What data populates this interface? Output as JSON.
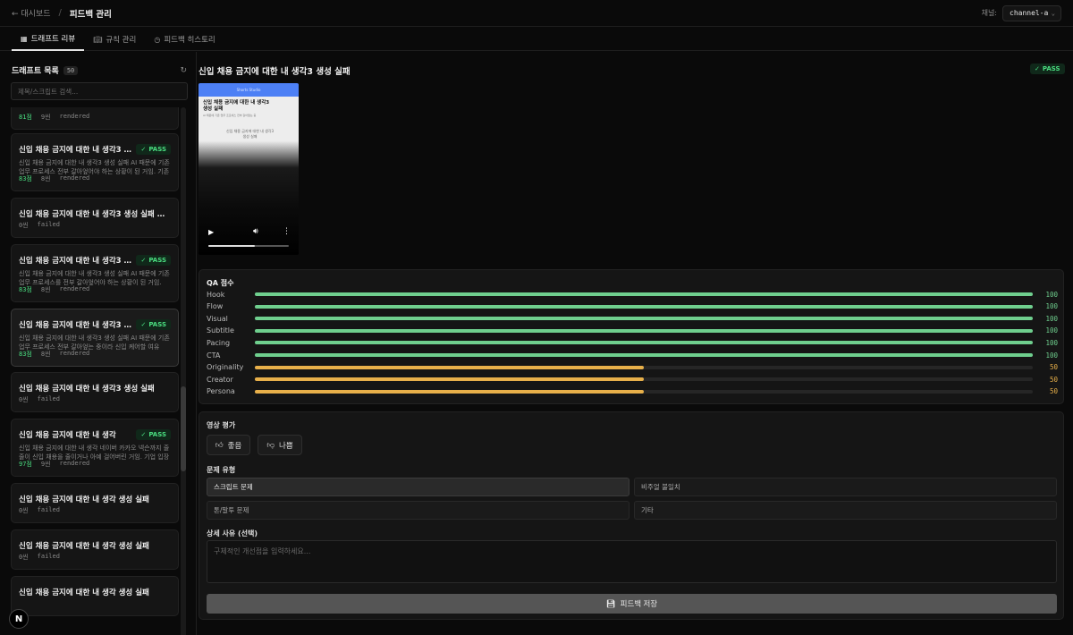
{
  "header": {
    "back_label": "← 대시보드",
    "separator": "/",
    "title": "피드백 관리",
    "channel_label": "채널:",
    "channel_value": "channel-a"
  },
  "tabs": [
    {
      "label": "드래프트 리뷰",
      "icon": "draft-icon",
      "active": true
    },
    {
      "label": "규칙 관리",
      "icon": "book-icon",
      "active": false
    },
    {
      "label": "피드백 히스토리",
      "icon": "clock-icon",
      "active": false
    }
  ],
  "drafts": {
    "title": "드래프트 목록",
    "count": "50",
    "search_placeholder": "제목/스크립트 검색...",
    "items": [
      {
        "title": "",
        "desc": "",
        "score": "81점",
        "scenes": "9씬",
        "status": "rendered",
        "pass": false
      },
      {
        "title": "신입 채용 금지에 대한 내 생각3 생성 실패",
        "desc": "신입 채용 금지에 대한 내 생각3 생성 실패 AI 때문에 기존 업무 프로세스 전부 갈아엎어야 하는 상황이 된 거임. 기존 ...",
        "score": "83점",
        "scenes": "8씬",
        "status": "rendered",
        "pass": true
      },
      {
        "title": "신입 채용 금지에 대한 내 생각3 생성 실패 생성 ...",
        "desc": "",
        "score": "",
        "scenes": "0씬",
        "status": "failed",
        "pass": false
      },
      {
        "title": "신입 채용 금지에 대한 내 생각3 생성 실패",
        "desc": "신입 채용 금지에 대한 내 생각3 생성 실패 AI 때문에 기존 업무 프로세스를 전부 갈아엎어야 하는 상황이 된 거임. 기...",
        "score": "83점",
        "scenes": "8씬",
        "status": "rendered",
        "pass": true
      },
      {
        "title": "신입 채용 금지에 대한 내 생각3 생성 실패",
        "desc": "신입 채용 금지에 대한 내 생각3 생성 실패 AI 때문에 기존 업무 프로세스 전부 갈아엎는 중이라 신입 케어할 여유 자...",
        "score": "83점",
        "scenes": "8씬",
        "status": "rendered",
        "pass": true
      },
      {
        "title": "신입 채용 금지에 대한 내 생각3 생성 실패",
        "desc": "",
        "score": "",
        "scenes": "0씬",
        "status": "failed",
        "pass": false
      },
      {
        "title": "신입 채용 금지에 대한 내 생각",
        "desc": "신입 채용 금지에 대한 내 생각 네이버 카카오 넥슨까지 줄줄이 신입 채용을 줄이거나 아예 걸어버린 거임. 기업 입장에...",
        "score": "97점",
        "scenes": "9씬",
        "status": "rendered",
        "pass": true
      },
      {
        "title": "신입 채용 금지에 대한 내 생각 생성 실패",
        "desc": "",
        "score": "",
        "scenes": "0씬",
        "status": "failed",
        "pass": false
      },
      {
        "title": "신입 채용 금지에 대한 내 생각 생성 실패",
        "desc": "",
        "score": "",
        "scenes": "0씬",
        "status": "failed",
        "pass": false
      },
      {
        "title": "신입 채용 금지에 대한 내 생각 생성 실패",
        "desc": "",
        "score": "",
        "scenes": "",
        "status": "",
        "pass": false
      }
    ],
    "pass_label": "PASS"
  },
  "detail": {
    "title": "신입 채용 금지에 대한 내 생각3 생성 실패",
    "pass_label": "PASS",
    "video": {
      "header_text": "Shorts Studio",
      "headline": "신입 채용 금지에 대한 내 생각3 생성 실패",
      "sub": "AI 때문에 기존 업무 프로세스 전부 갈아엎는 중",
      "ghost": "신입 채용 금지에 대한 내 생각3 생성 실패",
      "progress": 0.58
    }
  },
  "qa": {
    "title": "QA 점수",
    "rows": [
      {
        "label": "Hook",
        "value": 100
      },
      {
        "label": "Flow",
        "value": 100
      },
      {
        "label": "Visual",
        "value": 100
      },
      {
        "label": "Subtitle",
        "value": 100
      },
      {
        "label": "Pacing",
        "value": 100
      },
      {
        "label": "CTA",
        "value": 100
      },
      {
        "label": "Originality",
        "value": 50
      },
      {
        "label": "Creator",
        "value": 50
      },
      {
        "label": "Persona",
        "value": 50
      }
    ],
    "colors": {
      "high": "#6fcf8e",
      "mid": "#e8b04a"
    }
  },
  "evaluation": {
    "title": "영상 평가",
    "good_label": "좋음",
    "bad_label": "나쁨",
    "problem_type_title": "문제 유형",
    "options": [
      "스크립트 문제",
      "비주얼 불일치",
      "톤/말투 문제",
      "기타"
    ],
    "reason_title": "상세 사유 (선택)",
    "reason_placeholder": "구체적인 개선점을 입력하세요...",
    "save_label": "피드백 저장"
  }
}
